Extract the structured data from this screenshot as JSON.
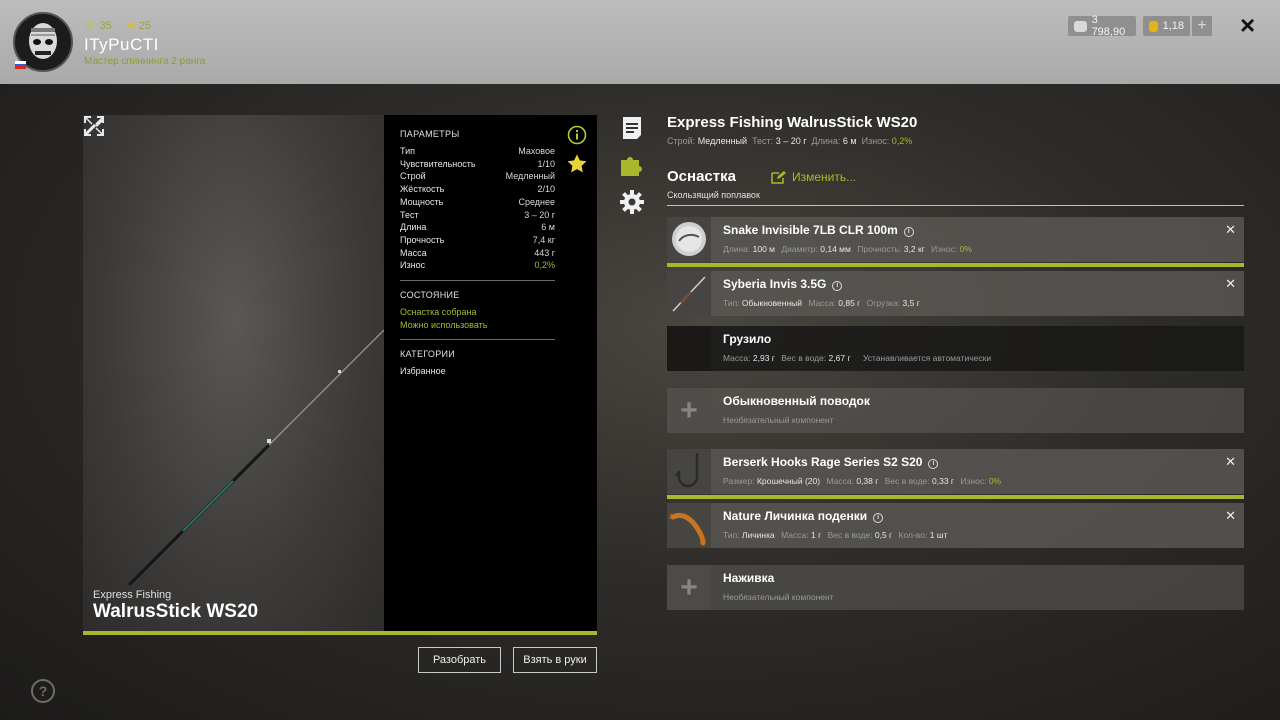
{
  "player": {
    "level": "35",
    "stars": "25",
    "nickname": "ITyPuCTI",
    "rank": "Мастер спиннинга 2 ранга"
  },
  "currency": {
    "silver": "3 798,90",
    "gold": "1,18",
    "add_label": "+"
  },
  "rod": {
    "brand": "Express Fishing",
    "model": "WalrusStick WS20",
    "full_name": "Express Fishing WalrusStick WS20",
    "specs": {
      "action_label": "Строй:",
      "action_value": "Медленный",
      "test_label": "Тест:",
      "test_value": "3 – 20 г",
      "length_label": "Длина:",
      "length_value": "6 м",
      "wear_label": "Износ:",
      "wear_value": "0,2%"
    }
  },
  "params": {
    "heading": "ПАРАМЕТРЫ",
    "rows": [
      {
        "k": "Тип",
        "v": "Маховое"
      },
      {
        "k": "Чувствительность",
        "v": "1/10"
      },
      {
        "k": "Строй",
        "v": "Медленный"
      },
      {
        "k": "Жёсткость",
        "v": "2/10"
      },
      {
        "k": "Мощность",
        "v": "Среднее"
      },
      {
        "k": "Тест",
        "v": "3 – 20 г"
      },
      {
        "k": "Длина",
        "v": "6 м"
      },
      {
        "k": "Прочность",
        "v": "7,4 кг"
      },
      {
        "k": "Масса",
        "v": "443 г"
      },
      {
        "k": "Износ",
        "v": "0,2%"
      }
    ],
    "state_heading": "СОСТОЯНИЕ",
    "state_1": "Оснастка собрана",
    "state_2": "Можно использовать",
    "cat_heading": "КАТЕГОРИИ",
    "cat_1": "Избранное"
  },
  "rig": {
    "title": "Оснастка",
    "change": "Изменить...",
    "subtitle": "Скользящий поплавок",
    "items": [
      {
        "name": "Snake Invisible 7LB CLR 100m",
        "meta": [
          {
            "k": "Длина:",
            "v": "100 м"
          },
          {
            "k": "Диаметр:",
            "v": "0,14 мм"
          },
          {
            "k": "Прочность:",
            "v": "3,2 кг"
          },
          {
            "k": "Износ:",
            "v": "0%"
          }
        ]
      },
      {
        "name": "Syberia Invis 3.5G",
        "meta": [
          {
            "k": "Тип:",
            "v": "Обыкновенный"
          },
          {
            "k": "Масса:",
            "v": "0,85 г"
          },
          {
            "k": "Огрузка:",
            "v": "3,5 г"
          }
        ]
      },
      {
        "name": "Грузило",
        "meta": [
          {
            "k": "Масса:",
            "v": "2,93 г"
          },
          {
            "k": "Вес в воде:",
            "v": "2,67 г"
          }
        ],
        "note": "Устанавливается автоматически"
      },
      {
        "name": "Обыкновенный поводок",
        "note": "Необязательный компонент"
      },
      {
        "name": "Berserk Hooks Rage Series S2 S20",
        "meta": [
          {
            "k": "Размер:",
            "v": "Крошечный (20)"
          },
          {
            "k": "Масса:",
            "v": "0,38 г"
          },
          {
            "k": "Вес в воде:",
            "v": "0,33 г"
          },
          {
            "k": "Износ:",
            "v": "0%"
          }
        ]
      },
      {
        "name": "Nature Личинка поденки",
        "meta": [
          {
            "k": "Тип:",
            "v": "Личинка"
          },
          {
            "k": "Масса:",
            "v": "1 г"
          },
          {
            "k": "Вес в воде:",
            "v": "0,5 г"
          },
          {
            "k": "Кол-во:",
            "v": "1 шт"
          }
        ]
      },
      {
        "name": "Наживка",
        "note": "Необязательный компонент"
      }
    ]
  },
  "buttons": {
    "disassemble": "Разобрать",
    "take": "Взять в руки"
  },
  "icons": {
    "close": "×",
    "remove": "✕",
    "info": "i",
    "help": "?"
  },
  "colors": {
    "accent": "#a7b92a",
    "topbar": "#b3b3b3",
    "panel": "#000000"
  }
}
